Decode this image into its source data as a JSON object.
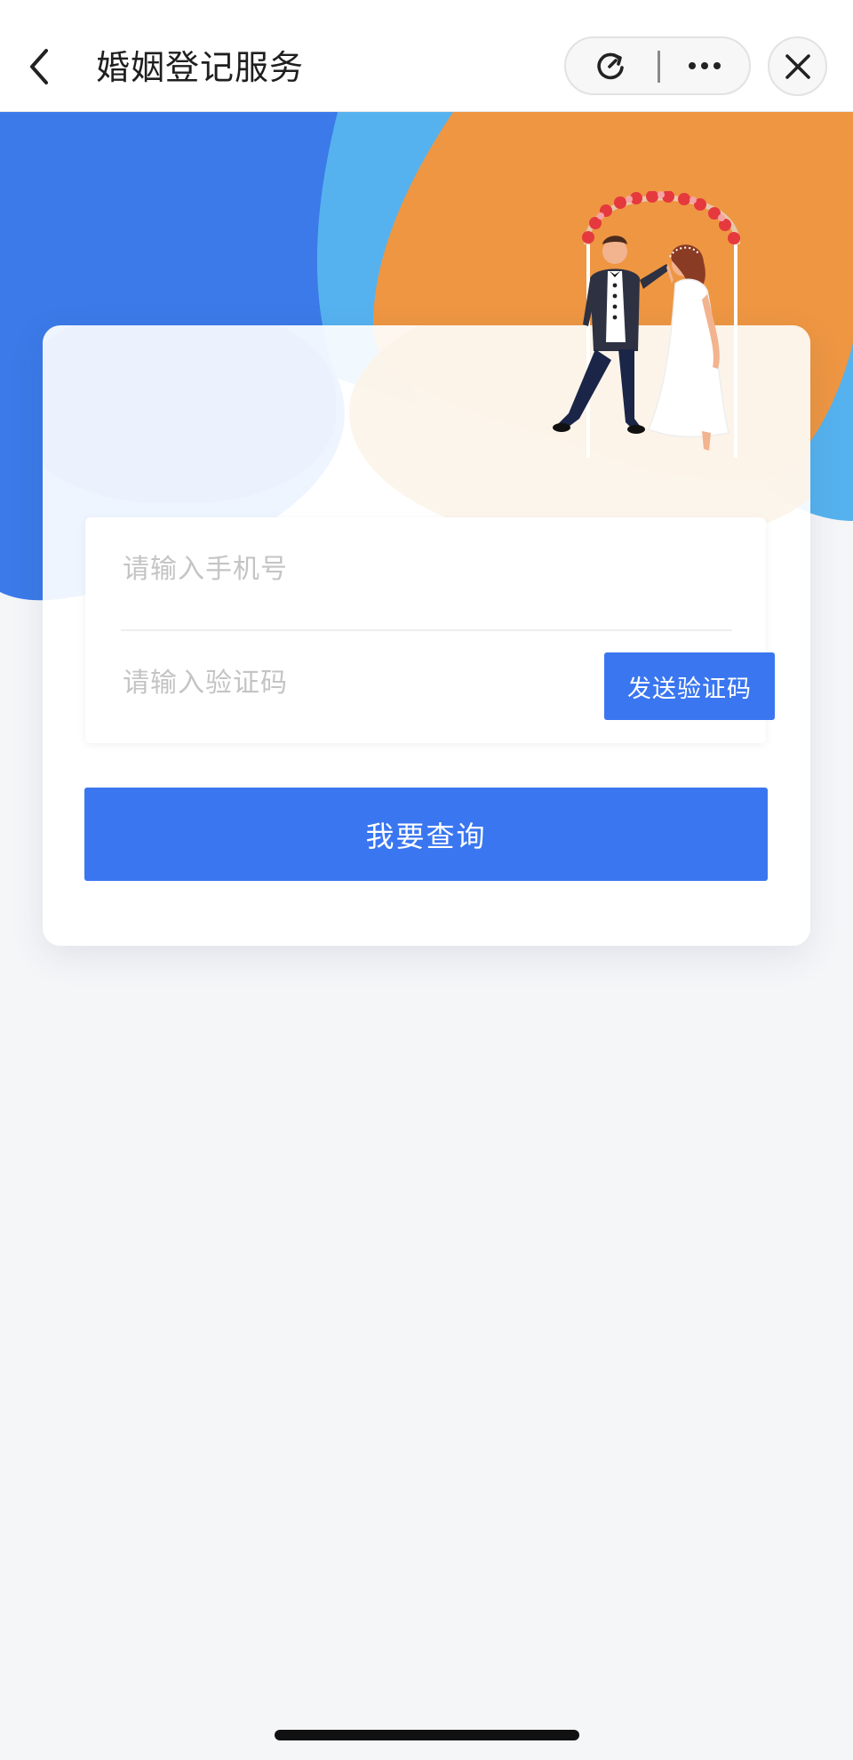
{
  "header": {
    "title": "婚姻登记服务",
    "back_icon": "chevron-left-icon",
    "refresh_icon": "refresh-icon",
    "more_icon": "more-dots-icon",
    "close_icon": "close-icon"
  },
  "form": {
    "phone_placeholder": "请输入手机号",
    "code_placeholder": "请输入验证码",
    "send_code_label": "发送验证码",
    "submit_label": "我要查询"
  },
  "colors": {
    "primary": "#3a76f0",
    "hero_blue": "#3b7ae8",
    "hero_orange": "#ee9642",
    "hero_light_blue": "#56b2ee"
  }
}
